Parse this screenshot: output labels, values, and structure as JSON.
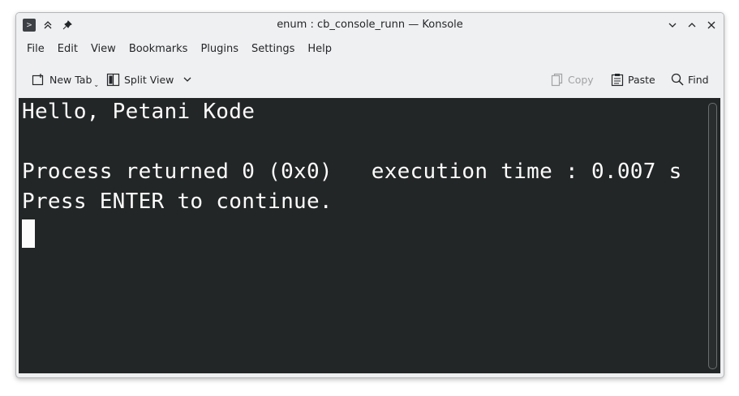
{
  "window": {
    "title": "enum : cb_console_runn — Konsole"
  },
  "menubar": {
    "items": [
      "File",
      "Edit",
      "View",
      "Bookmarks",
      "Plugins",
      "Settings",
      "Help"
    ]
  },
  "toolbar": {
    "new_tab": "New Tab",
    "split_view": "Split View",
    "copy": "Copy",
    "paste": "Paste",
    "find": "Find"
  },
  "terminal": {
    "lines": [
      "Hello, Petani Kode",
      "",
      "Process returned 0 (0x0)   execution time : 0.007 s",
      "Press ENTER to continue."
    ],
    "colors": {
      "background": "#232627",
      "foreground": "#fcfcfc"
    }
  }
}
